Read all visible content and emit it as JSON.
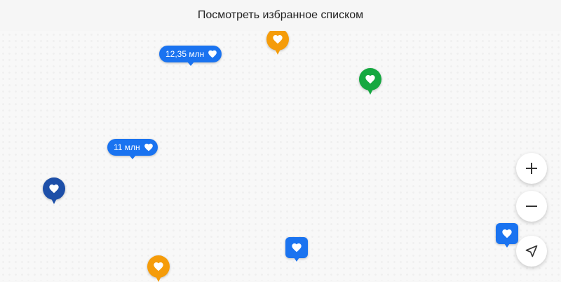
{
  "header": {
    "title": "Посмотреть избранное списком"
  },
  "colors": {
    "blue": "#1a73f0",
    "dark_blue": "#1d4fa8",
    "orange": "#f59c0a",
    "green": "#15a840"
  },
  "markers": {
    "price_pills": [
      {
        "label": "12,35 млн",
        "icon": "heart-icon"
      },
      {
        "label": "11 млн",
        "icon": "heart-icon"
      }
    ],
    "pins": [
      {
        "type": "orange-round-pin",
        "icon": "heart-icon"
      },
      {
        "type": "green-round-pin",
        "icon": "heart-icon"
      },
      {
        "type": "dark-blue-round-pin",
        "icon": "heart-icon"
      },
      {
        "type": "orange-round-pin",
        "icon": "heart-icon"
      },
      {
        "type": "blue-square-pin",
        "icon": "heart-icon"
      },
      {
        "type": "blue-square-pin",
        "icon": "heart-icon"
      }
    ]
  },
  "controls": {
    "zoom_in_icon": "plus-icon",
    "zoom_out_icon": "minus-icon",
    "locate_icon": "navigation-arrow-icon"
  }
}
